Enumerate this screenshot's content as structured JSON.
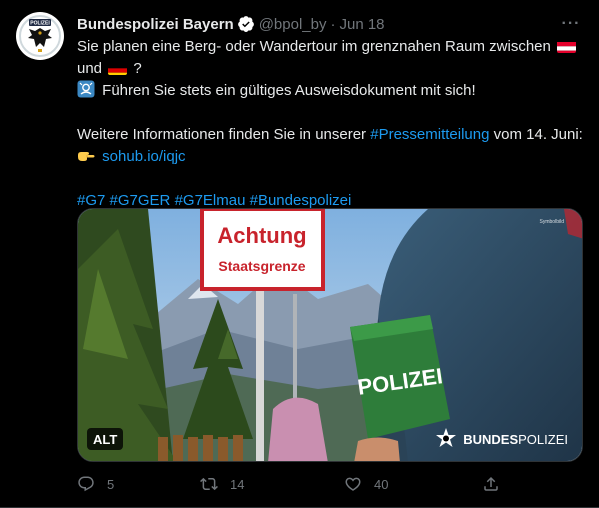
{
  "tweet": {
    "author_name": "Bundespolizei Bayern",
    "handle": "@bpol_by",
    "separator": "·",
    "time": "Jun 18",
    "more_label": "···",
    "text": {
      "line1": "Sie planen eine Berg- oder Wandertour im grenznahen Raum zwischen",
      "line2_start": "und",
      "line2_end": "?",
      "line3": "Führen Sie stets ein gültiges Ausweisdokument mit sich!",
      "line4_start": "Weitere Informationen finden Sie in unserer",
      "line4_link": "#Pressemitteilung",
      "line4_end": "vom 14. Juni:",
      "line5_link": "sohub.io/iqjc",
      "hashtags": [
        "#G7",
        "#G7GER",
        "#G7Elmau",
        "#Bundespolizei"
      ]
    },
    "media": {
      "sign_line1": "Achtung",
      "sign_line2": "Staatsgrenze",
      "armband_text": "POLIZEI",
      "alt_label": "ALT",
      "brand_bold": "BUNDES",
      "brand_regular": "POLIZEI",
      "symbol_text": "Symbolbild"
    },
    "actions": {
      "replies": "5",
      "retweets": "14",
      "likes": "40"
    }
  },
  "colors": {
    "background": "#000000",
    "text": "#e7e9ea",
    "muted": "#71767b",
    "link": "#1d9bf0",
    "verified": "#ffffff"
  },
  "icons": [
    "avatar-eagle-icon",
    "verified-badge-icon",
    "more-icon",
    "passport-emoji-icon",
    "pointing-hand-emoji-icon",
    "flag-austria-icon",
    "flag-germany-icon",
    "reply-icon",
    "retweet-icon",
    "like-icon",
    "share-icon",
    "bundespolizei-star-icon"
  ]
}
